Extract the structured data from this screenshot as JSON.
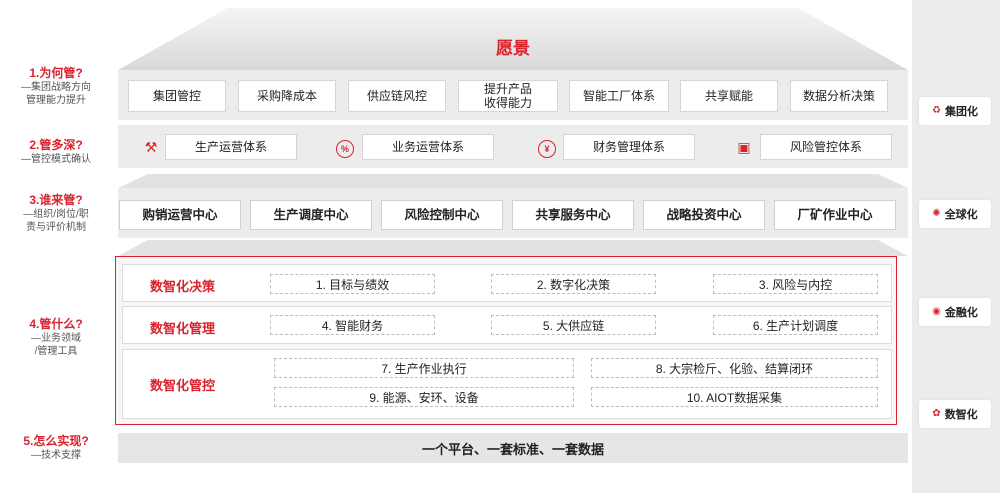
{
  "vision_title": "愿景",
  "questions": [
    {
      "title": "1.为何管?",
      "sub": [
        "—集团战略方向",
        "管理能力提升"
      ]
    },
    {
      "title": "2.管多深?",
      "sub": [
        "—管控模式确认"
      ]
    },
    {
      "title": "3.谁来管?",
      "sub": [
        "—组织/岗位/职",
        "责与评价机制"
      ]
    },
    {
      "title": "4.管什么?",
      "sub": [
        "—业务领域",
        "/管理工具"
      ]
    },
    {
      "title": "5.怎么实现?",
      "sub": [
        "—技术支撑"
      ]
    }
  ],
  "layer1": [
    "集团管控",
    "采购降成本",
    "供应链风控",
    "提升产品\n收得能力",
    "智能工厂体系",
    "共享赋能",
    "数据分析决策"
  ],
  "layer2": [
    {
      "icon": "robot-arm-icon",
      "glyph": "⚒",
      "label": "生产运营体系"
    },
    {
      "icon": "percent-badge-icon",
      "glyph": "%",
      "label": "业务运营体系"
    },
    {
      "icon": "yen-circle-icon",
      "glyph": "¥",
      "label": "财务管理体系"
    },
    {
      "icon": "monitor-chart-icon",
      "glyph": "▣",
      "label": "风险管控体系"
    }
  ],
  "layer3": [
    "购销运营中心",
    "生产调度中心",
    "风险控制中心",
    "共享服务中心",
    "战略投资中心",
    "厂矿作业中心"
  ],
  "rows": [
    {
      "label": "数智化决策",
      "items": [
        "1. 目标与绩效",
        "2. 数字化决策",
        "3. 风险与内控"
      ]
    },
    {
      "label": "数智化管理",
      "items": [
        "4. 智能财务",
        "5. 大供应链",
        "6. 生产计划调度"
      ]
    },
    {
      "label": "数智化管控",
      "items": [
        "7. 生产作业执行",
        "8. 大宗检斤、化验、结算闭环",
        "9. 能源、安环、设备",
        "10. AIOT数据采集"
      ]
    }
  ],
  "base": "一个平台、一套标准、一套数据",
  "tags": [
    {
      "icon": "group-icon",
      "glyph": "♻",
      "label": "集团化"
    },
    {
      "icon": "globe-icon",
      "glyph": "✺",
      "label": "全球化"
    },
    {
      "icon": "coin-stack-icon",
      "glyph": "◉",
      "label": "金融化"
    },
    {
      "icon": "network-icon",
      "glyph": "✿",
      "label": "数智化"
    }
  ],
  "colors": {
    "accent": "#d9232d",
    "panel_bg": "#ececec"
  }
}
